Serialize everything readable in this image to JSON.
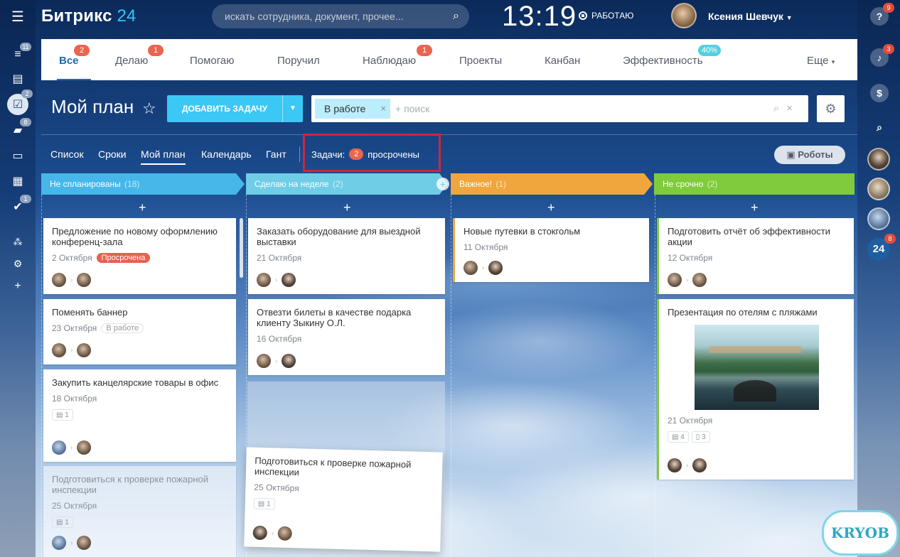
{
  "app": {
    "logo_name": "Битрикс",
    "logo_num": "24"
  },
  "header": {
    "search_placeholder": "искать сотрудника, документ, прочее...",
    "clock": "13:19",
    "status": "РАБОТАЮ",
    "user_name": "Ксения Шевчук"
  },
  "left_bar": {
    "badges": [
      "11",
      "2",
      "8",
      "1"
    ]
  },
  "right_bar": {
    "help_badge": "9",
    "bell_badge": "3",
    "b24_label": "24",
    "b24_badge": "8"
  },
  "tabs": [
    {
      "label": "Все",
      "badge": "2"
    },
    {
      "label": "Делаю",
      "badge": "1"
    },
    {
      "label": "Помогаю",
      "badge": ""
    },
    {
      "label": "Поручил",
      "badge": ""
    },
    {
      "label": "Наблюдаю",
      "badge": "1"
    },
    {
      "label": "Проекты",
      "badge": ""
    },
    {
      "label": "Канбан",
      "badge": ""
    },
    {
      "label": "Эффективность",
      "badge": "40%"
    },
    {
      "label": "Еще",
      "badge": ""
    }
  ],
  "title_row": {
    "title": "Мой план",
    "add_button": "ДОБАВИТЬ ЗАДАЧУ",
    "filter_chip": "В работе",
    "filter_search": "+ поиск"
  },
  "views": [
    "Список",
    "Сроки",
    "Мой план",
    "Календарь",
    "Гант"
  ],
  "counter": {
    "label": "Задачи:",
    "count": "2",
    "suffix": "просрочены"
  },
  "robots_button": "Роботы",
  "columns": [
    {
      "name": "Не спланированы",
      "count": "(18)",
      "color": "#47b7ea"
    },
    {
      "name": "Сделаю на неделе",
      "count": "(2)",
      "color": "#6fcde6"
    },
    {
      "name": "Важное!",
      "count": "(1)",
      "color": "#f0a63c"
    },
    {
      "name": "Не срочно",
      "count": "(2)",
      "color": "#7fcb3b"
    }
  ],
  "cards": {
    "c1": {
      "title": "Предложение по новому оформлению конференц-зала",
      "date": "2 Октября",
      "badge": "Просрочена"
    },
    "c2": {
      "title": "Поменять баннер",
      "date": "23 Октября",
      "badge": "В работе"
    },
    "c3": {
      "title": "Закупить канцелярские товары в офис",
      "date": "18 Октября",
      "chip": "1"
    },
    "c4": {
      "title": "Подготовиться к проверке пожарной инспекции",
      "date": "25 Октября",
      "chip": "1"
    },
    "c5": {
      "title": "Заказать оборудование для выездной выставки",
      "date": "21 Октября"
    },
    "c6": {
      "title": "Отвезти билеты в качестве подарка клиенту Зыкину О.Л.",
      "date": "16 Октября"
    },
    "c7": {
      "title": "Подготовиться к проверке пожарной инспекции",
      "date": "25 Октября",
      "chip": "1"
    },
    "c8": {
      "title": "Новые путевки в стокгольм",
      "date": "11 Октября"
    },
    "c9": {
      "title": "Подготовить отчёт об эффективности акции",
      "date": "12 Октября"
    },
    "c10": {
      "title": "Презентация по отелям с пляжами",
      "date": "21 Октября",
      "chip1": "4",
      "chip2": "3"
    }
  },
  "watermark": "KRYOB"
}
